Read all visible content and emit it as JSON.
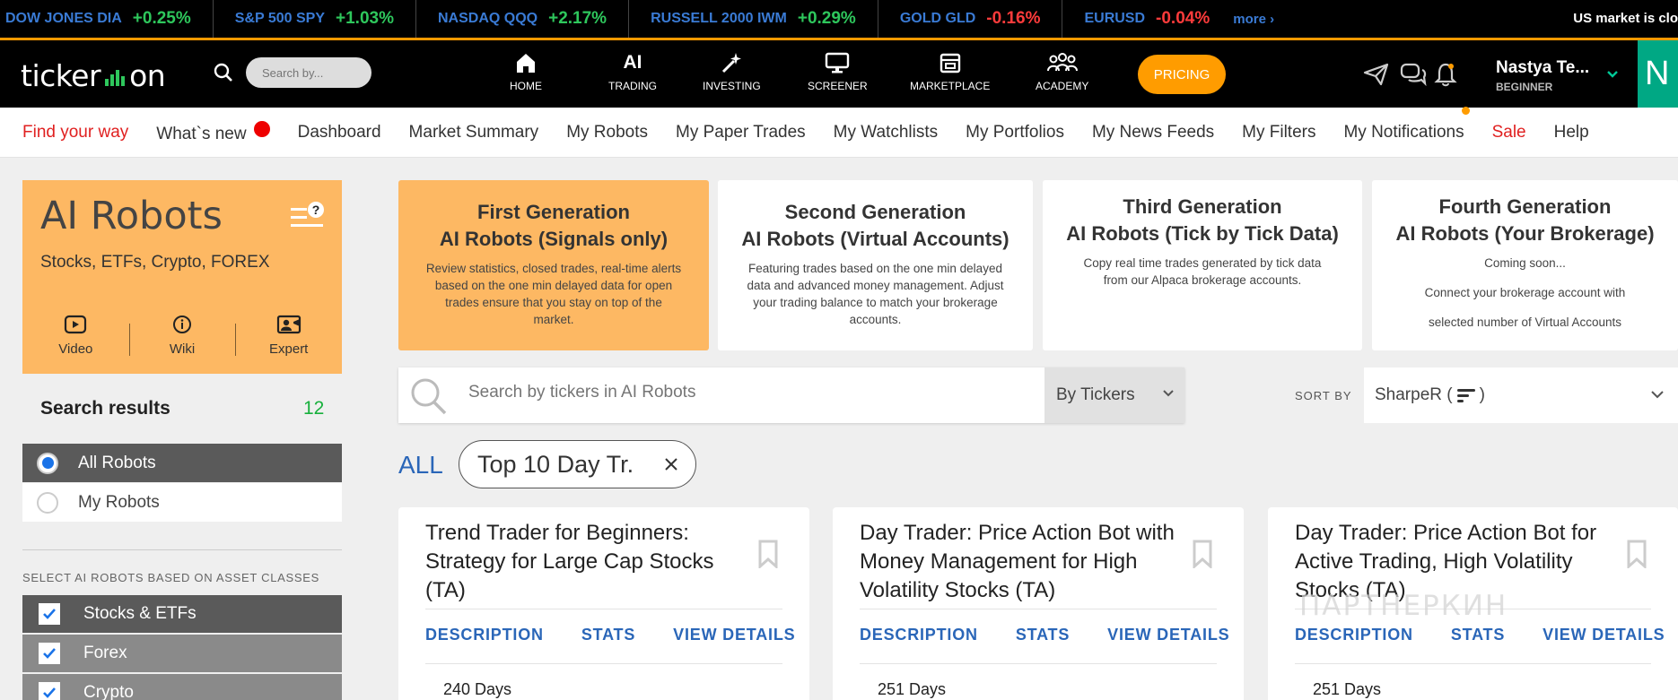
{
  "ticker": {
    "items": [
      {
        "name": "DOW JONES DIA",
        "change": "+0.25%",
        "dir": "up"
      },
      {
        "name": "S&P 500 SPY",
        "change": "+1.03%",
        "dir": "up"
      },
      {
        "name": "NASDAQ QQQ",
        "change": "+2.17%",
        "dir": "up"
      },
      {
        "name": "RUSSELL 2000 IWM",
        "change": "+0.29%",
        "dir": "up"
      },
      {
        "name": "GOLD GLD",
        "change": "-0.16%",
        "dir": "down"
      },
      {
        "name": "EURUSD",
        "change": "-0.04%",
        "dir": "down"
      }
    ],
    "more": "more ›",
    "market_status": "US market is clo"
  },
  "header": {
    "logo_left": "ticker",
    "logo_right": "on",
    "search_placeholder": "Search by...",
    "nav": [
      {
        "label": "HOME",
        "icon": "home-icon"
      },
      {
        "label": "TRADING",
        "icon_text": "AI"
      },
      {
        "label": "INVESTING",
        "icon": "magic-wand-icon"
      },
      {
        "label": "SCREENER",
        "icon": "monitor-icon"
      },
      {
        "label": "MARKETPLACE",
        "icon": "store-icon"
      },
      {
        "label": "ACADEMY",
        "icon": "people-icon"
      }
    ],
    "pricing": "PRICING",
    "user_name": "Nastya Te...",
    "user_role": "BEGINNER",
    "avatar_letter": "N",
    "accent": "#ff9c00",
    "avatar_bg": "#00a884"
  },
  "subnav": {
    "items": [
      {
        "label": "Find your way",
        "style": "red"
      },
      {
        "label": "What`s new",
        "dot": "red"
      },
      {
        "label": "Dashboard"
      },
      {
        "label": "Market Summary"
      },
      {
        "label": "My Robots"
      },
      {
        "label": "My Paper Trades"
      },
      {
        "label": "My Watchlists"
      },
      {
        "label": "My Portfolios"
      },
      {
        "label": "My News Feeds"
      },
      {
        "label": "My Filters"
      },
      {
        "label": "My Notifications",
        "dot": "orange"
      },
      {
        "label": "Sale",
        "style": "red"
      },
      {
        "label": "Help"
      }
    ]
  },
  "sidebar": {
    "title": "AI Robots",
    "subtitle": "Stocks, ETFs, Crypto, FOREX",
    "buttons": [
      {
        "label": "Video",
        "icon": "play-icon"
      },
      {
        "label": "Wiki",
        "icon": "info-icon"
      },
      {
        "label": "Expert",
        "icon": "expert-icon"
      }
    ],
    "search_results_label": "Search results",
    "search_results_count": "12",
    "options": [
      {
        "label": "All Robots",
        "selected": true
      },
      {
        "label": "My Robots",
        "selected": false
      }
    ],
    "asset_label": "SELECT AI ROBOTS BASED ON ASSET CLASSES",
    "assets": [
      {
        "label": "Stocks & ETFs",
        "checked": true
      },
      {
        "label": "Forex",
        "checked": true
      },
      {
        "label": "Crypto",
        "checked": true
      }
    ]
  },
  "generations": [
    {
      "title1": "First Generation",
      "title2": "AI Robots (Signals only)",
      "desc": [
        "Review statistics, closed trades, real-time alerts based on the one min delayed data for open trades ensure that you stay on top of the market."
      ],
      "active": true
    },
    {
      "title1": "Second Generation",
      "title2": "AI Robots (Virtual Accounts)",
      "desc": [
        "Featuring trades based on the one min delayed data and advanced money management. Adjust your trading balance to match your brokerage accounts."
      ],
      "active": false
    },
    {
      "title1": "Third Generation",
      "title2": "AI Robots (Tick by Tick Data)",
      "desc": [
        "Copy real time trades generated by tick data from our Alpaca brokerage accounts."
      ],
      "active": false
    },
    {
      "title1": "Fourth Generation",
      "title2": "AI Robots (Your Brokerage)",
      "desc": [
        "Coming soon...",
        "Connect your brokerage account with",
        "selected number of Virtual Accounts"
      ],
      "active": false
    }
  ],
  "search": {
    "placeholder": "Search by tickers in AI Robots",
    "mode": "By Tickers",
    "sort_label": "SORT BY",
    "sort_value": "SharpeR ( ",
    "sort_suffix": ")"
  },
  "filters": {
    "all": "ALL",
    "chip": "Top 10 Day Tr."
  },
  "robots": [
    {
      "title": "Trend Trader for Beginners: Strategy for Large Cap Stocks (TA)",
      "tabs": [
        "DESCRIPTION",
        "STATS",
        "VIEW DETAILS"
      ],
      "days": "240 Days"
    },
    {
      "title": "Day Trader: Price Action Bot with Money Management for High Volatility Stocks (TA)",
      "tabs": [
        "DESCRIPTION",
        "STATS",
        "VIEW DETAILS"
      ],
      "days": "251 Days"
    },
    {
      "title": "Day Trader: Price Action Bot for Active Trading, High Volatility Stocks (TA)",
      "tabs": [
        "DESCRIPTION",
        "STATS",
        "VIEW DETAILS"
      ],
      "days": "251 Days"
    }
  ],
  "watermark": "ПАРТНЕРКИН"
}
